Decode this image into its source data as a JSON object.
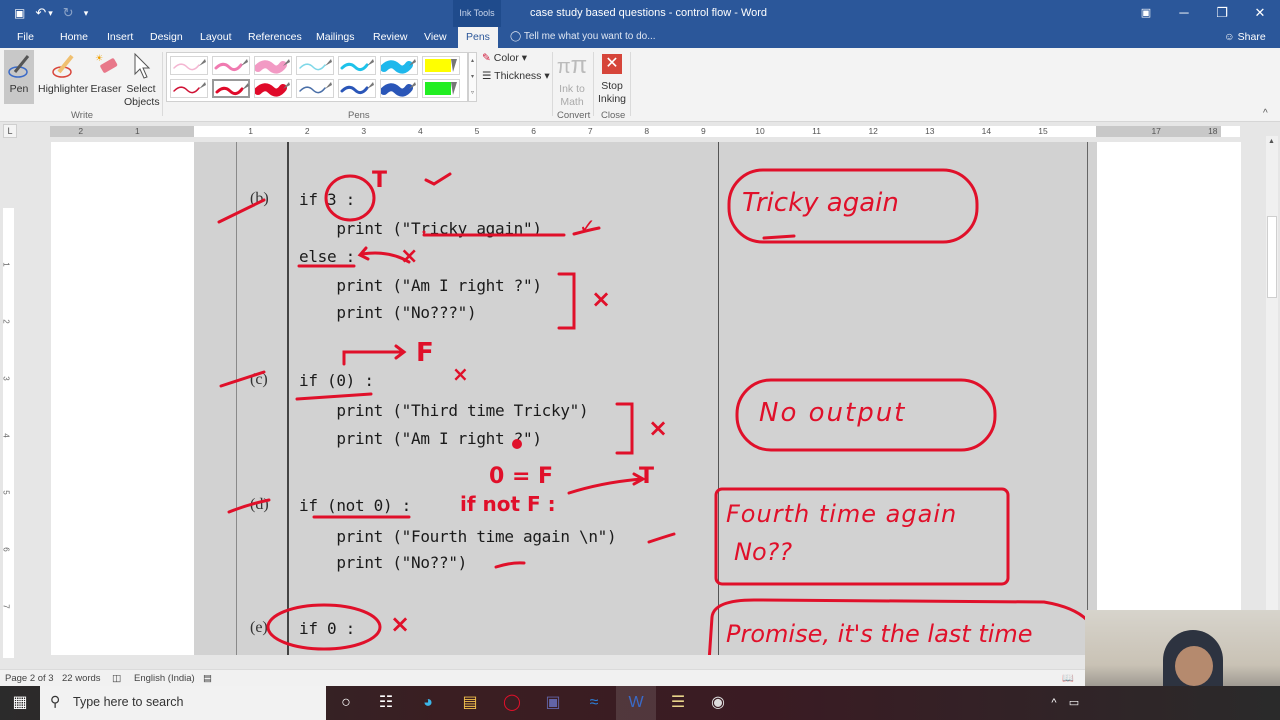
{
  "window": {
    "title": "case study based questions - control flow - Word",
    "context_tab": "Ink Tools",
    "controls": {
      "ribbon_display": "▣",
      "minimize": "─",
      "restore": "❐",
      "close": "✕"
    }
  },
  "qat": {
    "save_icon": "💾",
    "undo_icon": "↶",
    "undo_dropdown": "▾",
    "redo_icon": "↻",
    "customize": "▾"
  },
  "tabs": [
    {
      "label": "File"
    },
    {
      "label": "Home"
    },
    {
      "label": "Insert"
    },
    {
      "label": "Design"
    },
    {
      "label": "Layout"
    },
    {
      "label": "References"
    },
    {
      "label": "Mailings"
    },
    {
      "label": "Review"
    },
    {
      "label": "View"
    },
    {
      "label": "Pens",
      "active": true
    }
  ],
  "tell_me": "Tell me what you want to do...",
  "share": "Share",
  "ribbon": {
    "write": {
      "group_label": "Write",
      "pen": "Pen",
      "highlighter": "Highlighter",
      "eraser": "Eraser",
      "select_line1": "Select",
      "select_line2": "Objects"
    },
    "pens": {
      "group_label": "Pens",
      "row1": [
        "#f4b6d2",
        "#f07ab0",
        "#f29ac4",
        "#7fd8e8",
        "#1ec2ea",
        "#1fb8ec",
        "#ffff00"
      ],
      "row2": [
        "#d01235",
        "#e00a2a",
        "#e00a2a",
        "#4a6fa8",
        "#2a56b8",
        "#2a56b8",
        "#22ee22"
      ],
      "selected_index": 8,
      "color": "Color",
      "thickness": "Thickness"
    },
    "convert": {
      "group_label": "Convert",
      "line1": "Ink to",
      "line2": "Math"
    },
    "close": {
      "group_label": "Close",
      "line1": "Stop",
      "line2": "Inking"
    }
  },
  "ruler": {
    "corner": "L",
    "left_numbers": [
      "2",
      "1"
    ],
    "numbers": [
      "1",
      "2",
      "3",
      "4",
      "5",
      "6",
      "7",
      "8",
      "9",
      "10",
      "11",
      "12",
      "13",
      "14",
      "15"
    ],
    "right_numbers": [
      "17",
      "18"
    ],
    "vertical_numbers": [
      "1",
      "2",
      "3",
      "4",
      "5",
      "6",
      "7"
    ]
  },
  "document": {
    "questions": [
      {
        "label": "(b)",
        "lines": [
          "if 3 :",
          "    print (\"Tricky again\")",
          "else :",
          "    print (\"Am I right ?\")",
          "    print (\"No???\")"
        ]
      },
      {
        "label": "(c)",
        "lines": [
          "if (0) :",
          "    print (\"Third time Tricky\")",
          "    print (\"Am I right ?\")"
        ]
      },
      {
        "label": "(d)",
        "lines": [
          "if (not 0) :",
          "    print (\"Fourth time again \\n\")",
          "    print (\"No??\")"
        ]
      },
      {
        "label": "(e)",
        "lines": [
          "if 0 :"
        ]
      }
    ],
    "ink_annotations": {
      "b_T": "T",
      "b_check1": "✓",
      "b_check2": "✓",
      "b_x1": "×",
      "b_x2": "×",
      "c_F": "F",
      "c_x1": "×",
      "c_x2": "×",
      "d_note1": "0 = F",
      "d_T": "T",
      "d_note2": "if not F :",
      "d_check": "✓",
      "e_x": "×"
    },
    "answers": [
      {
        "text": "Tricky again"
      },
      {
        "text": "No output"
      },
      {
        "line1": "Fourth time again",
        "line2": "No??"
      },
      {
        "text": "Promise, it's the last time"
      }
    ]
  },
  "statusbar": {
    "page": "Page 2 of 3",
    "words": "22 words",
    "language": "English (India)"
  },
  "taskbar": {
    "search_placeholder": "Type here to search",
    "apps": [
      "cortana",
      "task-view",
      "edge",
      "file-explorer",
      "opera",
      "teams",
      "whiteboard",
      "word",
      "python-file",
      "obs"
    ]
  }
}
